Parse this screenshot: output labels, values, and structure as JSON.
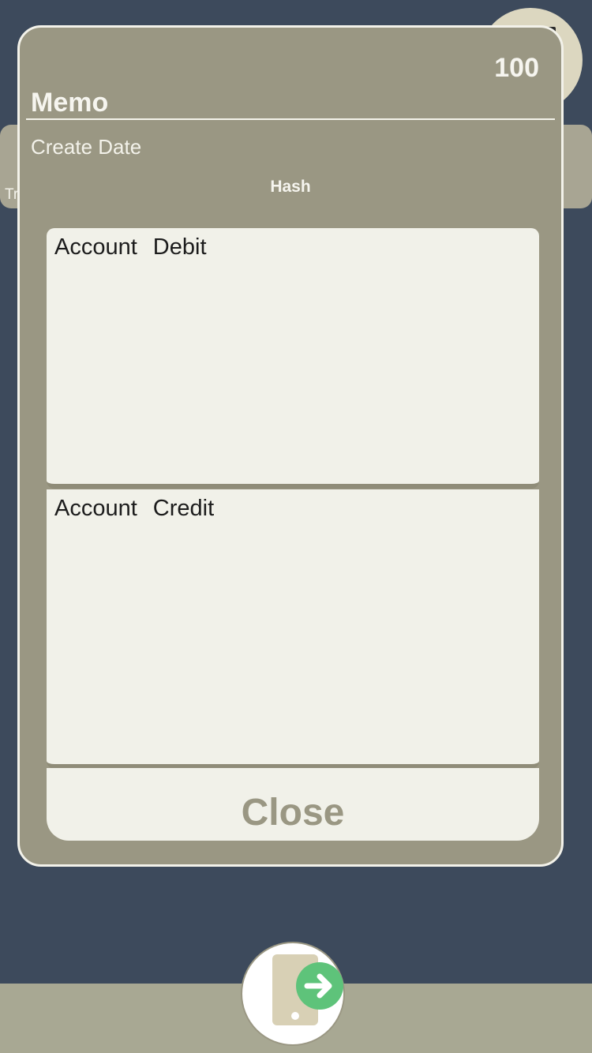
{
  "background": {
    "card_text": "Tr"
  },
  "modal": {
    "amount": "100",
    "title": "Memo",
    "create_date_label": "Create Date",
    "hash_label": "Hash",
    "debit_panel": {
      "account_label": "Account",
      "type_label": "Debit"
    },
    "credit_panel": {
      "account_label": "Account",
      "type_label": "Credit"
    },
    "close_label": "Close"
  },
  "fab": {
    "icon": "phone-transfer-icon"
  },
  "colors": {
    "background": "#3d4a5c",
    "modal": "#9a9783",
    "panel": "#f1f1e9",
    "accent_green": "#5ec37a"
  }
}
